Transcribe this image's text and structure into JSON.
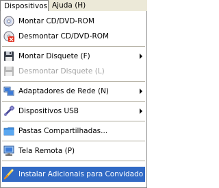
{
  "menubar": {
    "items": [
      {
        "label": "Dispositivos"
      },
      {
        "label": "Ajuda (H)"
      }
    ]
  },
  "menu": {
    "items": [
      {
        "label": "Montar CD/DVD-ROM",
        "icon": "cd-icon"
      },
      {
        "label": "Desmontar CD/DVD-ROM",
        "icon": "cd-unmount-icon"
      },
      {
        "label": "Montar Disquete (F)",
        "icon": "floppy-icon"
      },
      {
        "label": "Desmontar Disquete (L)",
        "icon": "floppy-disabled-icon"
      },
      {
        "label": "Adaptadores de Rede (N)",
        "icon": "network-icon"
      },
      {
        "label": "Dispositivos USB",
        "icon": "usb-icon"
      },
      {
        "label": "Pastas Compartilhadas...",
        "icon": "folder-icon"
      },
      {
        "label": "Tela Remota (P)",
        "icon": "monitor-icon"
      },
      {
        "label": "Instalar Adicionais para Convidado",
        "icon": "install-icon"
      }
    ]
  },
  "colors": {
    "menubar_bg": "#ece9d8",
    "highlight": "#316ac5",
    "disabled_text": "#a0a0a0"
  }
}
